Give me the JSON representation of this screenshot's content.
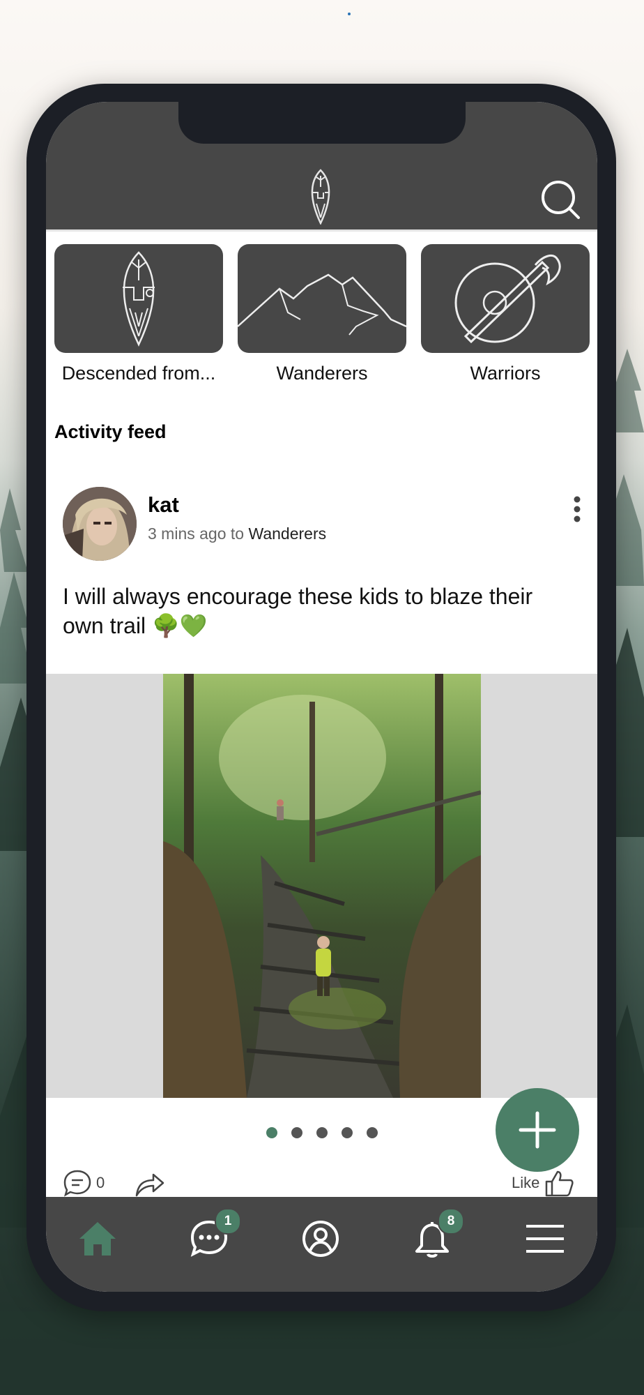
{
  "header": {
    "logo_icon": "shield-face-logo-icon",
    "search_icon": "search-icon"
  },
  "groups": [
    {
      "label": "Descended from...",
      "icon": "shield-face-icon"
    },
    {
      "label": "Wanderers",
      "icon": "mountains-icon"
    },
    {
      "label": "Warriors",
      "icon": "shield-axe-icon"
    }
  ],
  "feed": {
    "title": "Activity feed",
    "post": {
      "author": "kat",
      "time": "3 mins ago to",
      "group": "Wanderers",
      "text": "I will always encourage these kids to blaze their own trail 🌳💚",
      "image_count": 5,
      "active_image": 1,
      "comments": "0",
      "like_label": "Like"
    }
  },
  "tabbar": {
    "home_icon": "home-icon",
    "messages_badge": "1",
    "notifications_badge": "8",
    "profile_icon": "user-circle-icon",
    "menu_icon": "hamburger-menu-icon"
  },
  "colors": {
    "accent": "#4b7f67",
    "bar": "#474747",
    "device": "#1c1f26",
    "media_bg": "#dadada"
  }
}
